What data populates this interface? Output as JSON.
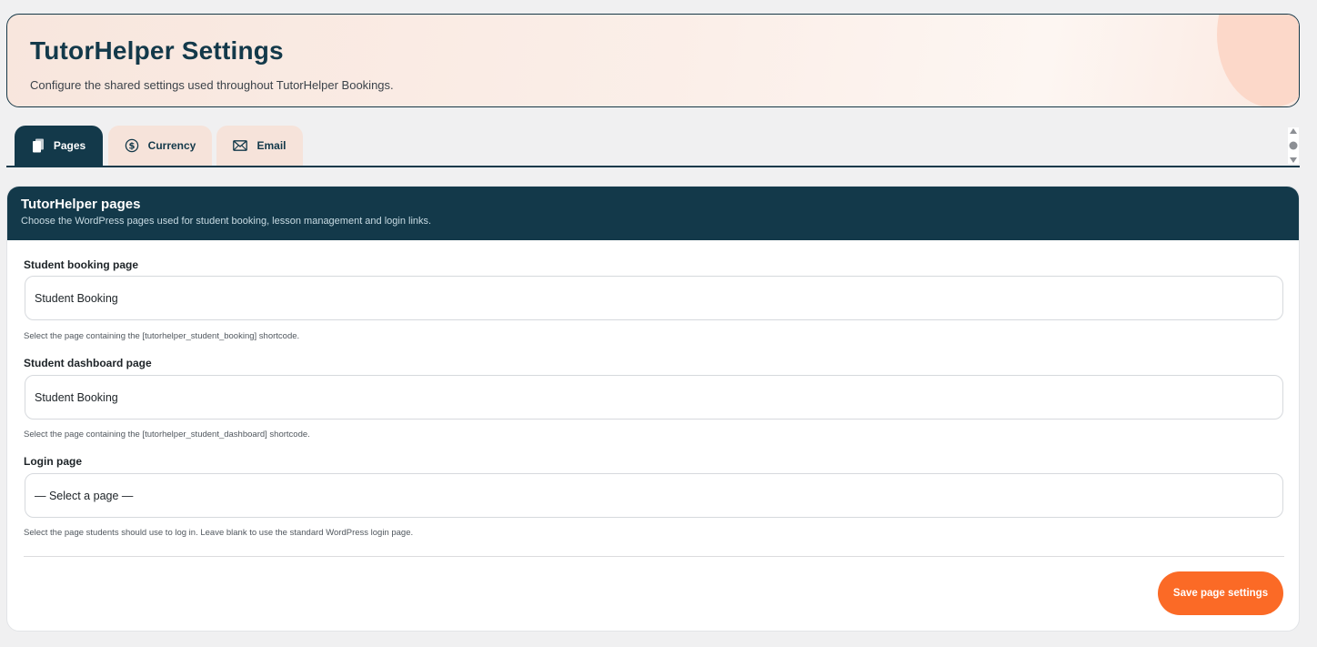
{
  "header": {
    "title": "TutorHelper Settings",
    "subtitle": "Configure the shared settings used throughout TutorHelper Bookings."
  },
  "tabs": [
    {
      "label": "Pages",
      "icon": "pages-icon",
      "active": true
    },
    {
      "label": "Currency",
      "icon": "dollar-circle-icon",
      "active": false
    },
    {
      "label": "Email",
      "icon": "envelope-icon",
      "active": false
    }
  ],
  "card": {
    "title": "TutorHelper pages",
    "description": "Choose the WordPress pages used for student booking, lesson management and login links.",
    "fields": [
      {
        "label": "Student booking page",
        "value": "Student Booking",
        "help": "Select the page containing the [tutorhelper_student_booking] shortcode."
      },
      {
        "label": "Student dashboard page",
        "value": "Student Booking",
        "help": "Select the page containing the [tutorhelper_student_dashboard] shortcode."
      },
      {
        "label": "Login page",
        "value": "— Select a page —",
        "help": "Select the page students should use to log in. Leave blank to use the standard WordPress login page."
      }
    ],
    "save_label": "Save page settings"
  },
  "colors": {
    "navy": "#13394a",
    "accent": "#fb6a26",
    "tab_inactive": "#f6e3da"
  }
}
